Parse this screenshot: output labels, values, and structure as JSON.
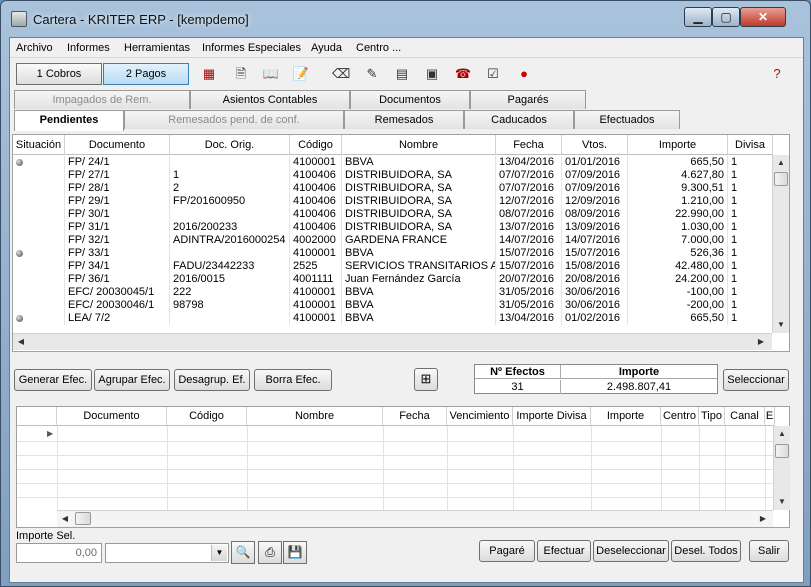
{
  "window": {
    "title": "Cartera - KRITER ERP - [kempdemo]"
  },
  "menu": [
    "Archivo",
    "Informes",
    "Herramientas",
    "Informes Especiales",
    "Ayuda",
    "Centro ..."
  ],
  "toolbar": {
    "cobros_label": "1 Cobros",
    "pagos_label": "2 Pagos"
  },
  "tabs_top": [
    {
      "label": "Impagados de Rem.",
      "disabled": true
    },
    {
      "label": "Asientos Contables"
    },
    {
      "label": "Documentos"
    },
    {
      "label": "Pagarés"
    }
  ],
  "tabs_bottom": [
    {
      "label": "Pendientes",
      "active": true
    },
    {
      "label": "Remesados pend. de conf.",
      "disabled": true
    },
    {
      "label": "Remesados"
    },
    {
      "label": "Caducados"
    },
    {
      "label": "Efectuados"
    }
  ],
  "grid": {
    "headers": [
      "Situación",
      "Documento",
      "Doc. Orig.",
      "Código",
      "Nombre",
      "Fecha",
      "Vtos.",
      "Importe",
      "Divisa"
    ],
    "rows": [
      {
        "dot": true,
        "documento": "FP/ 24/1",
        "orig": "",
        "codigo": "4100001",
        "nombre": "BBVA",
        "fecha": "13/04/2016",
        "vtos": "01/01/2016",
        "importe": "665,50",
        "divisa": "1"
      },
      {
        "dot": false,
        "documento": "FP/ 27/1",
        "orig": "1",
        "codigo": "4100406",
        "nombre": "DISTRIBUIDORA, SA",
        "fecha": "07/07/2016",
        "vtos": "07/09/2016",
        "importe": "4.627,80",
        "divisa": "1"
      },
      {
        "dot": false,
        "documento": "FP/ 28/1",
        "orig": "2",
        "codigo": "4100406",
        "nombre": "DISTRIBUIDORA, SA",
        "fecha": "07/07/2016",
        "vtos": "07/09/2016",
        "importe": "9.300,51",
        "divisa": "1"
      },
      {
        "dot": false,
        "documento": "FP/ 29/1",
        "orig": "FP/201600950",
        "codigo": "4100406",
        "nombre": "DISTRIBUIDORA, SA",
        "fecha": "12/07/2016",
        "vtos": "12/09/2016",
        "importe": "1.210,00",
        "divisa": "1"
      },
      {
        "dot": false,
        "documento": "FP/ 30/1",
        "orig": "",
        "codigo": "4100406",
        "nombre": "DISTRIBUIDORA, SA",
        "fecha": "08/07/2016",
        "vtos": "08/09/2016",
        "importe": "22.990,00",
        "divisa": "1"
      },
      {
        "dot": false,
        "documento": "FP/ 31/1",
        "orig": "2016/200233",
        "codigo": "4100406",
        "nombre": "DISTRIBUIDORA, SA",
        "fecha": "13/07/2016",
        "vtos": "13/09/2016",
        "importe": "1.030,00",
        "divisa": "1"
      },
      {
        "dot": false,
        "documento": "FP/ 32/1",
        "orig": "ADINTRA/2016000254",
        "codigo": "4002000",
        "nombre": "GARDENA FRANCE",
        "fecha": "14/07/2016",
        "vtos": "14/07/2016",
        "importe": "7.000,00",
        "divisa": "1"
      },
      {
        "dot": true,
        "documento": "FP/ 33/1",
        "orig": "",
        "codigo": "4100001",
        "nombre": "BBVA",
        "fecha": "15/07/2016",
        "vtos": "15/07/2016",
        "importe": "526,36",
        "divisa": "1"
      },
      {
        "dot": false,
        "documento": "FP/ 34/1",
        "orig": "FADU/23442233",
        "codigo": "2525",
        "nombre": "SERVICIOS TRANSITARIOS A",
        "fecha": "15/07/2016",
        "vtos": "15/08/2016",
        "importe": "42.480,00",
        "divisa": "1"
      },
      {
        "dot": false,
        "documento": "FP/ 36/1",
        "orig": "2016/0015",
        "codigo": "4001111",
        "nombre": "Juan Fernández García",
        "fecha": "20/07/2016",
        "vtos": "20/08/2016",
        "importe": "24.200,00",
        "divisa": "1"
      },
      {
        "dot": false,
        "documento": "EFC/ 20030045/1",
        "orig": "222",
        "codigo": "4100001",
        "nombre": "BBVA",
        "fecha": "31/05/2016",
        "vtos": "30/06/2016",
        "importe": "-100,00",
        "divisa": "1"
      },
      {
        "dot": false,
        "documento": "EFC/ 20030046/1",
        "orig": "98798",
        "codigo": "4100001",
        "nombre": "BBVA",
        "fecha": "31/05/2016",
        "vtos": "30/06/2016",
        "importe": "-200,00",
        "divisa": "1"
      },
      {
        "dot": true,
        "documento": "LEA/ 7/2",
        "orig": "",
        "codigo": "4100001",
        "nombre": "BBVA",
        "fecha": "13/04/2016",
        "vtos": "01/02/2016",
        "importe": "665,50",
        "divisa": "1"
      }
    ]
  },
  "actions": {
    "generar": "Generar Efec.",
    "agrupar": "Agrupar Efec.",
    "desagrup": "Desagrup. Ef.",
    "borra": "Borra Efec.",
    "seleccionar": "Seleccionar"
  },
  "summary": {
    "efectos_label": "Nº Efectos",
    "importe_label": "Importe",
    "efectos_value": "31",
    "importe_value": "2.498.807,41"
  },
  "grid2": {
    "headers": [
      "Documento",
      "Código",
      "Nombre",
      "Fecha",
      "Vencimiento",
      "Importe Divisa",
      "Importe",
      "Centro",
      "Tipo",
      "Canal",
      "E"
    ]
  },
  "bottom": {
    "importe_sel_label": "Importe Sel.",
    "importe_sel_value": "0,00",
    "pagare": "Pagaré",
    "efectuar": "Efectuar",
    "deseleccionar": "Deseleccionar",
    "desel_todos": "Desel. Todos",
    "salir": "Salir"
  }
}
